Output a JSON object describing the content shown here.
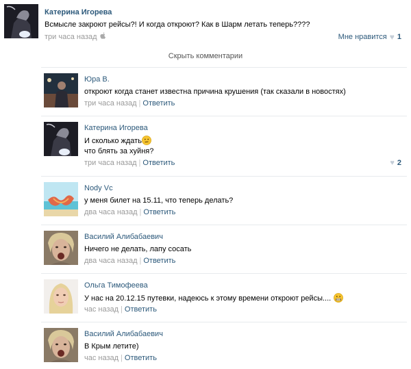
{
  "post": {
    "author": "Катерина Игорева",
    "text": "Всмысле закроют рейсы?! И когда откроют? Как в Шарм летать теперь????",
    "time": "три часа назад",
    "like_label": "Мне нравится",
    "like_count": "1"
  },
  "hide_comments_label": "Скрыть комментарии",
  "comments": [
    {
      "author": "Юра В.",
      "text": "откроют когда станет известна причина крушения (так сказали в новостях)",
      "time": "три часа назад",
      "reply": "Ответить"
    },
    {
      "author": "Катерина Игорева",
      "text_line1": "И сколько ждать",
      "text_line2": "что блять за хуйня?",
      "time": "три часа назад",
      "reply": "Ответить",
      "likes": "2"
    },
    {
      "author": "Nody Vc",
      "text": "у меня билет на 15.11, что теперь делать?",
      "time": "два часа назад",
      "reply": "Ответить"
    },
    {
      "author": "Василий Алибабаевич",
      "text": "Ничего не делать, лапу сосать",
      "time": "два часа назад",
      "reply": "Ответить"
    },
    {
      "author": "Ольга Тимофеева",
      "text": "У нас на 20.12.15 путевки, надеюсь к этому времени откроют рейсы....",
      "time": "час назад",
      "reply": "Ответить"
    },
    {
      "author": "Василий Алибабаевич",
      "text": "В Крым летите)",
      "time": "час назад",
      "reply": "Ответить"
    }
  ]
}
